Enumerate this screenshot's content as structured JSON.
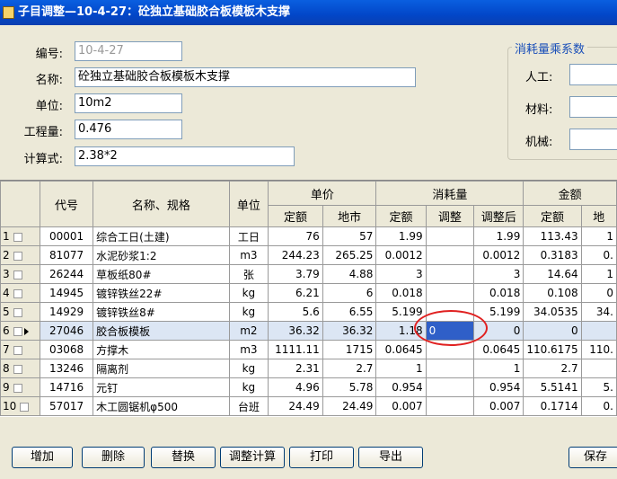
{
  "window": {
    "title": "子目调整—10-4-27：砼独立基础胶合板模板木支撑"
  },
  "form": {
    "code_label": "编号:",
    "code_value": "10-4-27",
    "name_label": "名称:",
    "name_value": "砼独立基础胶合板模板木支撑",
    "unit_label": "单位:",
    "unit_value": "10m2",
    "qty_label": "工程量:",
    "qty_value": "0.476",
    "formula_label": "计算式:",
    "formula_value": "2.38*2"
  },
  "coef": {
    "title": "消耗量乘系数",
    "labor_label": "人工:",
    "material_label": "材料:",
    "machine_label": "机械:"
  },
  "table": {
    "headers": {
      "code": "代号",
      "name": "名称、规格",
      "unit": "单位",
      "price": "单价",
      "consumption": "消耗量",
      "amount": "金额",
      "quota": "定额",
      "local": "地市",
      "quota2": "定额",
      "adjust": "调整",
      "adjusted": "调整后",
      "quota3": "定额",
      "local2": "地"
    },
    "rows": [
      [
        "1",
        "00001",
        "综合工日(土建)",
        "工日",
        "76",
        "57",
        "1.99",
        "",
        "1.99",
        "113.43",
        "1"
      ],
      [
        "2",
        "81077",
        "水泥砂浆1:2",
        "m3",
        "244.23",
        "265.25",
        "0.0012",
        "",
        "0.0012",
        "0.3183",
        "0."
      ],
      [
        "3",
        "26244",
        "草板纸80#",
        "张",
        "3.79",
        "4.88",
        "3",
        "",
        "3",
        "14.64",
        "1"
      ],
      [
        "4",
        "14945",
        "镀锌铁丝22#",
        "kg",
        "6.21",
        "6",
        "0.018",
        "",
        "0.018",
        "0.108",
        "0"
      ],
      [
        "5",
        "14929",
        "镀锌铁丝8#",
        "kg",
        "5.6",
        "6.55",
        "5.199",
        "",
        "5.199",
        "34.0535",
        "34."
      ],
      [
        "6",
        "27046",
        "胶合板模板",
        "m2",
        "36.32",
        "36.32",
        "1.18",
        "0",
        "0",
        "0",
        ""
      ],
      [
        "7",
        "03068",
        "方撑木",
        "m3",
        "1111.11",
        "1715",
        "0.0645",
        "",
        "0.0645",
        "110.6175",
        "110."
      ],
      [
        "8",
        "13246",
        "隔离剂",
        "kg",
        "2.31",
        "2.7",
        "1",
        "",
        "1",
        "2.7",
        ""
      ],
      [
        "9",
        "14716",
        "元钉",
        "kg",
        "4.96",
        "5.78",
        "0.954",
        "",
        "0.954",
        "5.5141",
        "5."
      ],
      [
        "10",
        "57017",
        "木工圆锯机φ500",
        "台班",
        "24.49",
        "24.49",
        "0.007",
        "",
        "0.007",
        "0.1714",
        "0."
      ]
    ]
  },
  "buttons": {
    "add": "增加",
    "delete": "删除",
    "replace": "替换",
    "adjust_calc": "调整计算",
    "print": "打印",
    "export": "导出",
    "save": "保存"
  }
}
